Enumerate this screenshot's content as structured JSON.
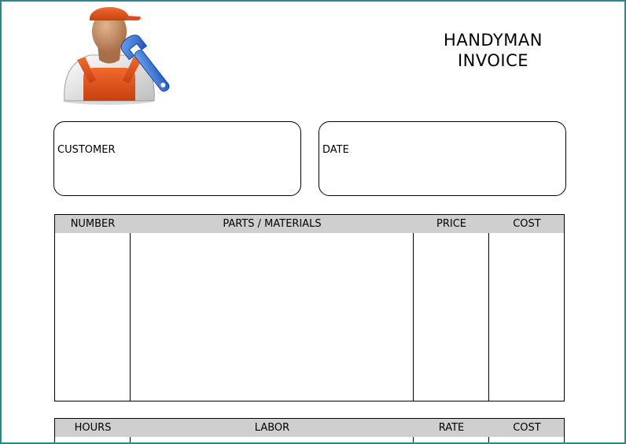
{
  "title": {
    "line1": "HANDYMAN",
    "line2": "INVOICE"
  },
  "customer_box": {
    "label": "CUSTOMER"
  },
  "date_box": {
    "label": "DATE"
  },
  "parts_table": {
    "columns": [
      "NUMBER",
      "PARTS / MATERIALS",
      "PRICE",
      "COST"
    ],
    "header_color": "#cfcfcf"
  },
  "labor_table": {
    "columns": [
      "HOURS",
      "LABOR",
      "RATE",
      "COST"
    ],
    "header_color": "#cfcfcf"
  },
  "colors": {
    "frame_border": "#2a8a86",
    "overalls": "#e0521e",
    "wrench": "#2f6fd6",
    "skin": "#c89067"
  }
}
